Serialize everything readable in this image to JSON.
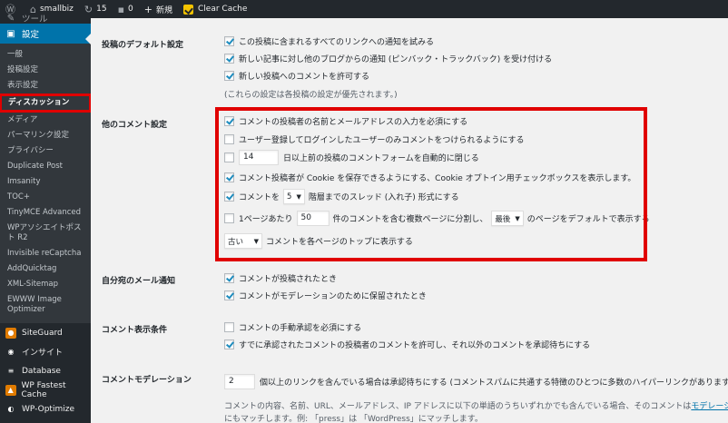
{
  "adminbar": {
    "items": [
      {
        "icon": "wordpress-icon",
        "glyph": "Ⓦ",
        "label": ""
      },
      {
        "icon": "home-icon",
        "glyph": "⌂",
        "label": "smallbiz"
      },
      {
        "icon": "updates-icon",
        "glyph": "↻",
        "label": "15"
      },
      {
        "icon": "comments-icon",
        "glyph": "▪",
        "label": "0"
      },
      {
        "icon": "plus-icon",
        "glyph": "+",
        "label": "新規"
      },
      {
        "icon": "clear-cache-icon",
        "glyph": "",
        "label": "Clear Cache"
      }
    ]
  },
  "sidebar": {
    "top_items": [
      {
        "label": "ツール",
        "icon": "tools-icon",
        "glyph": "✎"
      },
      {
        "label": "設定",
        "icon": "settings-icon",
        "glyph": "▣"
      }
    ],
    "submenu": [
      "一般",
      "投稿設定",
      "表示設定",
      "ディスカッション",
      "メディア",
      "パーマリンク設定",
      "プライバシー",
      "Duplicate Post",
      "Imsanity",
      "TOC+",
      "TinyMCE Advanced",
      "WPアソシエイトポスト R2",
      "Invisible reCaptcha",
      "AddQuicktag",
      "XML-Sitemap",
      "EWWW Image Optimizer"
    ],
    "plugins": [
      {
        "label": "SiteGuard",
        "icon": "siteguard-icon",
        "color": "#e07b00",
        "glyph": "●"
      },
      {
        "label": "インサイト",
        "icon": "insights-icon",
        "color": "#555d66",
        "glyph": "◉"
      },
      {
        "label": "Database",
        "icon": "database-icon",
        "color": "#555d66",
        "glyph": "≡"
      },
      {
        "label": "WP Fastest Cache",
        "icon": "fastest-cache-icon",
        "color": "#e07b00",
        "glyph": "▲"
      },
      {
        "label": "WP-Optimize",
        "icon": "wp-optimize-icon",
        "color": "#555d66",
        "glyph": "◐"
      }
    ]
  },
  "default_post": {
    "label": "投稿のデフォルト設定",
    "opt1": "この投稿に含まれるすべてのリンクへの通知を試みる",
    "opt2": "新しい記事に対し他のブログからの通知 (ピンバック・トラックバック) を受け付ける",
    "opt3": "新しい投稿へのコメントを許可する",
    "note": "(これらの設定は各投稿の設定が優先されます。)"
  },
  "other_comment": {
    "label": "他のコメント設定",
    "opt1": "コメントの投稿者の名前とメールアドレスの入力を必須にする",
    "opt2": "ユーザー登録してログインしたユーザーのみコメントをつけられるようにする",
    "close_days": "14",
    "opt3": "日以上前の投稿のコメントフォームを自動的に閉じる",
    "opt4": "コメント投稿者が Cookie を保存できるようにする、Cookie オプトイン用チェックボックスを表示します。",
    "thread_pre": "コメントを",
    "thread_depth": "5",
    "thread_post": "階層までのスレッド (入れ子) 形式にする",
    "page_pre": "1ページあたり",
    "per_page": "50",
    "page_mid": "件のコメントを含む複数ページに分割し、",
    "default_page": "最後",
    "page_post": "のページをデフォルトで表示する",
    "order": "古い",
    "order_post": "コメントを各ページのトップに表示する"
  },
  "email_me": {
    "label": "自分宛のメール通知",
    "opt1": "コメントが投稿されたとき",
    "opt2": "コメントがモデレーションのために保留されたとき"
  },
  "before_appear": {
    "label": "コメント表示条件",
    "opt1": "コメントの手動承認を必須にする",
    "opt2": "すでに承認されたコメントの投稿者のコメントを許可し、それ以外のコメントを承認待ちにする"
  },
  "moderation": {
    "label": "コメントモデレーション",
    "links": "2",
    "text": "個以上のリンクを含んでいる場合は承認待ちにする (コメントスパムに共通する特徴のひとつに多数のハイパーリンクがあります) 。",
    "desc1": "コメントの内容、名前、URL、メールアドレス、IP アドレスに以下の単語のうちいずれかでも含んでいる場合、そのコメントは",
    "desc1_link": "モデレーション待",
    "desc2": "にもマッチします。例: 「press」は 「WordPress」にマッチします。"
  },
  "colors": {
    "highlight": "#e00000",
    "accent": "#0073aa",
    "sidebar": "#23282d"
  }
}
